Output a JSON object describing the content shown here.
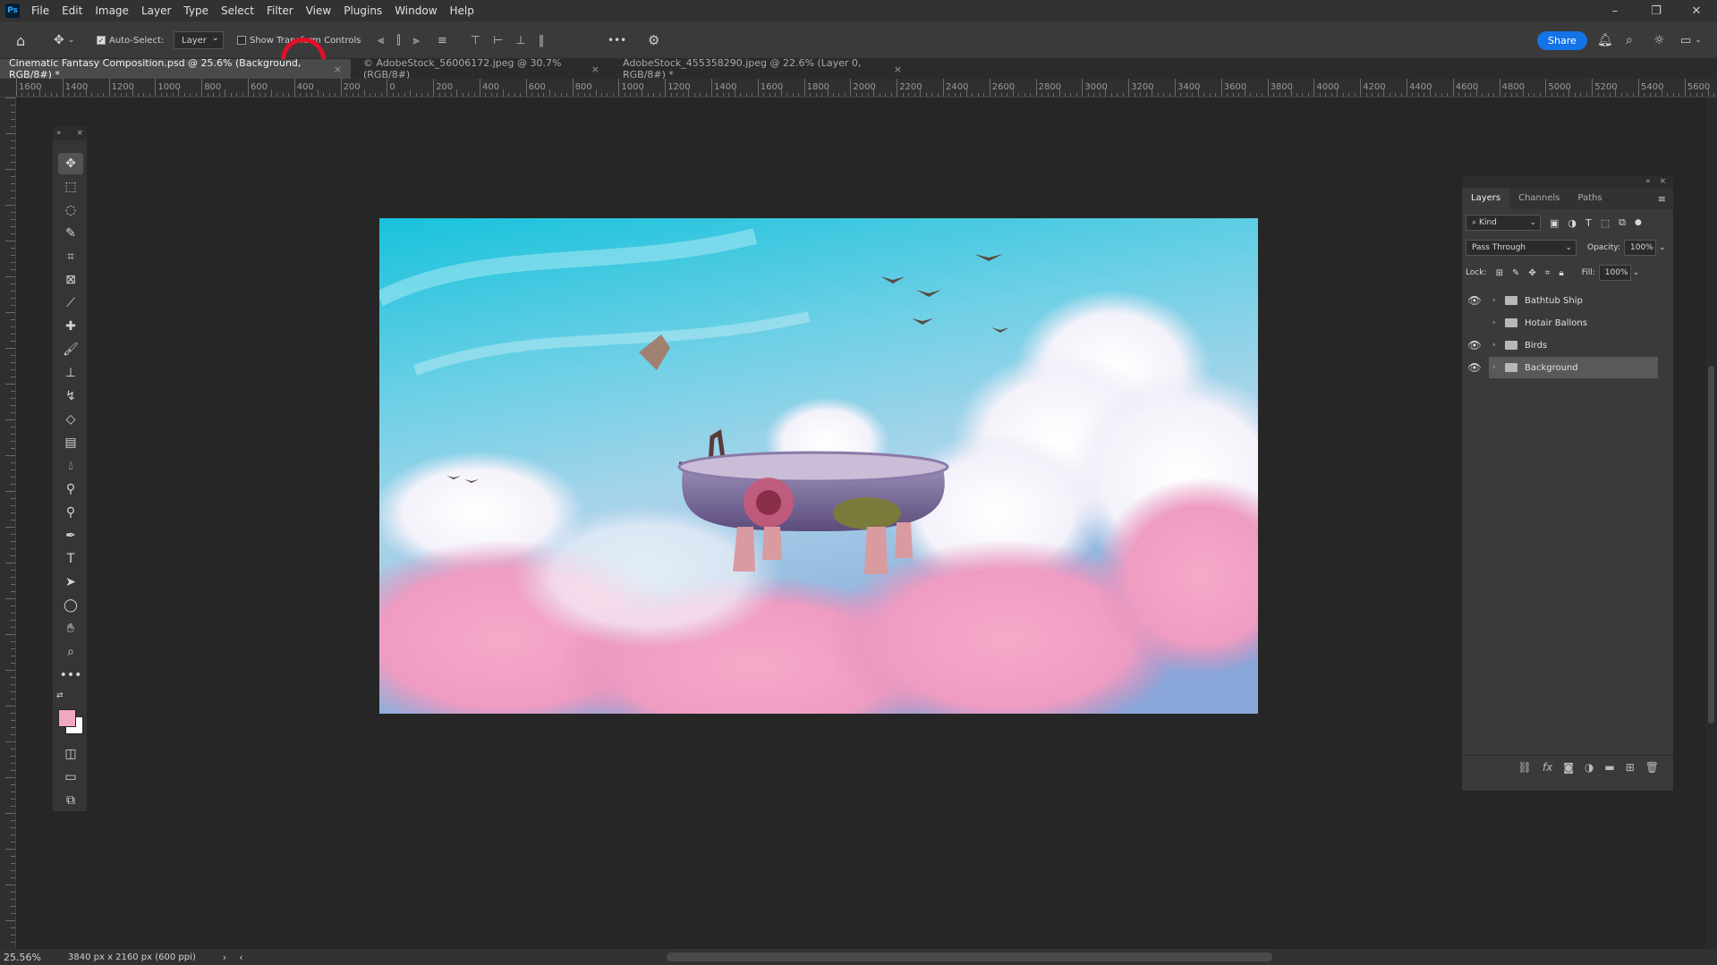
{
  "app": {
    "logo": "Ps"
  },
  "menu": [
    "File",
    "Edit",
    "Image",
    "Layer",
    "Type",
    "Select",
    "Filter",
    "View",
    "Plugins",
    "Window",
    "Help"
  ],
  "window_controls": {
    "minimize": "–",
    "restore": "❐",
    "close": "✕"
  },
  "options_bar": {
    "auto_select_label": "Auto-Select:",
    "auto_select_checked": true,
    "auto_select_target": "Layer",
    "show_transform_label": "Show Transform Controls",
    "more": "•••",
    "share_label": "Share"
  },
  "tabs": [
    {
      "label": "Cinematic Fantasy Composition.psd @ 25.6% (Background, RGB/8#) *",
      "active": true
    },
    {
      "label": "© AdobeStock_56006172.jpeg @ 30.7% (RGB/8#)",
      "active": false
    },
    {
      "label": "AdobeStock_455358290.jpeg @ 22.6% (Layer 0, RGB/8#) *",
      "active": false
    }
  ],
  "ruler_labels": [
    "1600",
    "1400",
    "1200",
    "1000",
    "800",
    "600",
    "400",
    "200",
    "0",
    "200",
    "400",
    "600",
    "800",
    "1000",
    "1200",
    "1400",
    "1600",
    "1800",
    "2000",
    "2200",
    "2400",
    "2600",
    "2800",
    "3000",
    "3200",
    "3400",
    "3600",
    "3800",
    "4000",
    "4200",
    "4400",
    "4600",
    "4800",
    "5000",
    "5200",
    "5400",
    "5600"
  ],
  "tools": [
    "move-tool",
    "marquee-tool",
    "lasso-tool",
    "quick-select-tool",
    "crop-tool",
    "frame-tool",
    "eyedropper-tool",
    "healing-brush-tool",
    "brush-tool",
    "clone-stamp-tool",
    "history-brush-tool",
    "eraser-tool",
    "gradient-tool",
    "blur-tool",
    "dodge-tool",
    "burn-tool",
    "pen-tool",
    "type-tool",
    "path-selection-tool",
    "ellipse-tool",
    "hand-tool",
    "zoom-tool",
    "edit-toolbar"
  ],
  "colors": {
    "foreground": "#f2a7c0",
    "background": "#ffffff",
    "accent": "#1473e6",
    "highlight": "#e0102a"
  },
  "layers_panel": {
    "tabs": [
      "Layers",
      "Channels",
      "Paths"
    ],
    "filter_label": "Kind",
    "blend_mode": "Pass Through",
    "opacity_label": "Opacity:",
    "opacity_value": "100%",
    "lock_label": "Lock:",
    "fill_label": "Fill:",
    "fill_value": "100%",
    "layers": [
      {
        "name": "Bathtub Ship",
        "visible": true,
        "selected": false
      },
      {
        "name": "Hotair Ballons",
        "visible": false,
        "selected": false
      },
      {
        "name": "Birds",
        "visible": true,
        "selected": false
      },
      {
        "name": "Background",
        "visible": true,
        "selected": true
      }
    ]
  },
  "status": {
    "zoom": "25.56%",
    "doc_size": "3840 px x 2160 px (600 ppi)"
  }
}
